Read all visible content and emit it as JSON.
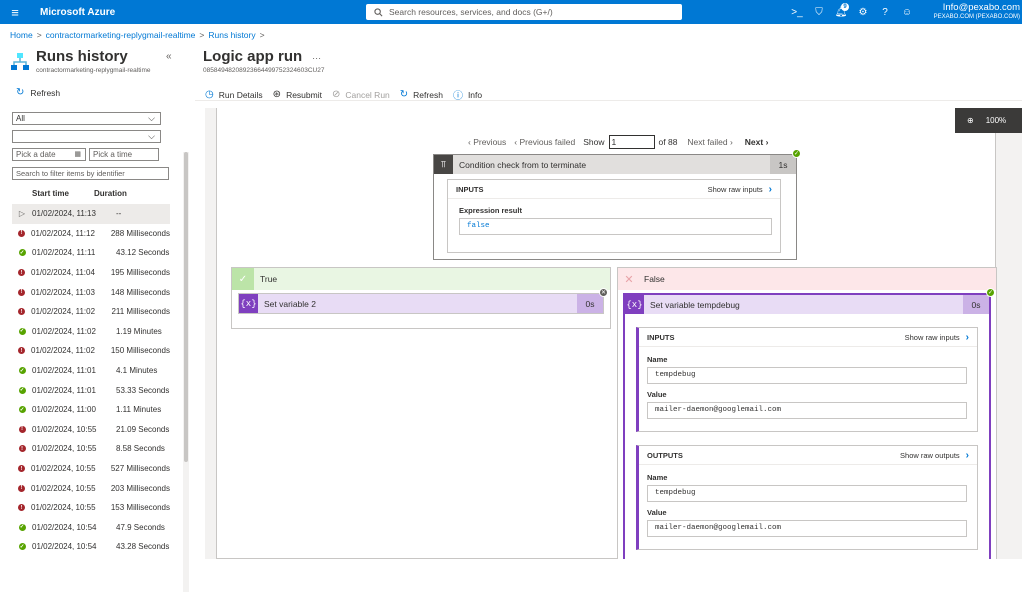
{
  "topbar": {
    "brand": "Microsoft Azure",
    "search_placeholder": "Search resources, services, and docs (G+/)",
    "notif_count": "9",
    "account_email": "Info@pexabo.com",
    "account_dir": "PEXABO.COM (PEXABO.COM)"
  },
  "breadcrumb": [
    "Home",
    "contractormarketing-replygmail-realtime",
    "Runs history"
  ],
  "left": {
    "title": "Runs history",
    "subtitle": "contractormarketing-replygmail-realtime",
    "refresh": "Refresh",
    "status_filter": "All",
    "trigger_filter": "",
    "date_placeholder": "Pick a date",
    "time_placeholder": "Pick a time",
    "search_placeholder": "Search to filter items by identifier",
    "col_start": "Start time",
    "col_duration": "Duration",
    "rows": [
      {
        "status": "running",
        "time": "01/02/2024, 11:13",
        "duration": "--"
      },
      {
        "status": "failed",
        "time": "01/02/2024, 11:12",
        "duration": "288 Milliseconds"
      },
      {
        "status": "succeeded",
        "time": "01/02/2024, 11:11",
        "duration": "43.12 Seconds"
      },
      {
        "status": "failed",
        "time": "01/02/2024, 11:04",
        "duration": "195 Milliseconds"
      },
      {
        "status": "failed",
        "time": "01/02/2024, 11:03",
        "duration": "148 Milliseconds"
      },
      {
        "status": "failed",
        "time": "01/02/2024, 11:02",
        "duration": "211 Milliseconds"
      },
      {
        "status": "succeeded",
        "time": "01/02/2024, 11:02",
        "duration": "1.19 Minutes"
      },
      {
        "status": "failed",
        "time": "01/02/2024, 11:02",
        "duration": "150 Milliseconds"
      },
      {
        "status": "succeeded",
        "time": "01/02/2024, 11:01",
        "duration": "4.1 Minutes"
      },
      {
        "status": "succeeded",
        "time": "01/02/2024, 11:01",
        "duration": "53.33 Seconds"
      },
      {
        "status": "succeeded",
        "time": "01/02/2024, 11:00",
        "duration": "1.11 Minutes"
      },
      {
        "status": "failed",
        "time": "01/02/2024, 10:55",
        "duration": "21.09 Seconds"
      },
      {
        "status": "failed",
        "time": "01/02/2024, 10:55",
        "duration": "8.58 Seconds"
      },
      {
        "status": "failed",
        "time": "01/02/2024, 10:55",
        "duration": "527 Milliseconds"
      },
      {
        "status": "failed",
        "time": "01/02/2024, 10:55",
        "duration": "203 Milliseconds"
      },
      {
        "status": "failed",
        "time": "01/02/2024, 10:55",
        "duration": "153 Milliseconds"
      },
      {
        "status": "succeeded",
        "time": "01/02/2024, 10:54",
        "duration": "47.9 Seconds"
      },
      {
        "status": "succeeded",
        "time": "01/02/2024, 10:54",
        "duration": "43.28 Seconds"
      }
    ]
  },
  "main": {
    "title": "Logic app run",
    "run_id": "08584948208923664499752324603CU27",
    "toolbar": {
      "run_details": "Run Details",
      "resubmit": "Resubmit",
      "cancel": "Cancel Run",
      "refresh": "Refresh",
      "info": "Info"
    },
    "zoom": "100%",
    "pager": {
      "previous": "Previous",
      "previous_failed": "Previous failed",
      "show": "Show",
      "current": "1",
      "of": "of 88",
      "next_failed": "Next failed",
      "next": "Next"
    },
    "condition": {
      "title": "Condition check from to terminate",
      "duration": "1s",
      "inputs_label": "INPUTS",
      "show_raw_inputs": "Show raw inputs",
      "expr_label": "Expression result",
      "expr_value": "false"
    },
    "true_branch": {
      "label": "True",
      "action_title": "Set variable 2",
      "duration": "0s"
    },
    "false_branch": {
      "label": "False",
      "action_title": "Set variable tempdebug",
      "duration": "0s",
      "inputs_label": "INPUTS",
      "show_raw_inputs": "Show raw inputs",
      "outputs_label": "OUTPUTS",
      "show_raw_outputs": "Show raw outputs",
      "name_label": "Name",
      "value_label": "Value",
      "in_name": "tempdebug",
      "in_value": "mailer-daemon@googlemail.com",
      "out_name": "tempdebug",
      "out_value": "mailer-daemon@googlemail.com"
    }
  },
  "colors": {
    "azure_blue": "#0078d4",
    "success": "#57a300",
    "failed": "#a4262c",
    "variable_purple": "#7f3fbf",
    "true_green": "#e9f6e3",
    "false_red": "#fde7e9"
  }
}
